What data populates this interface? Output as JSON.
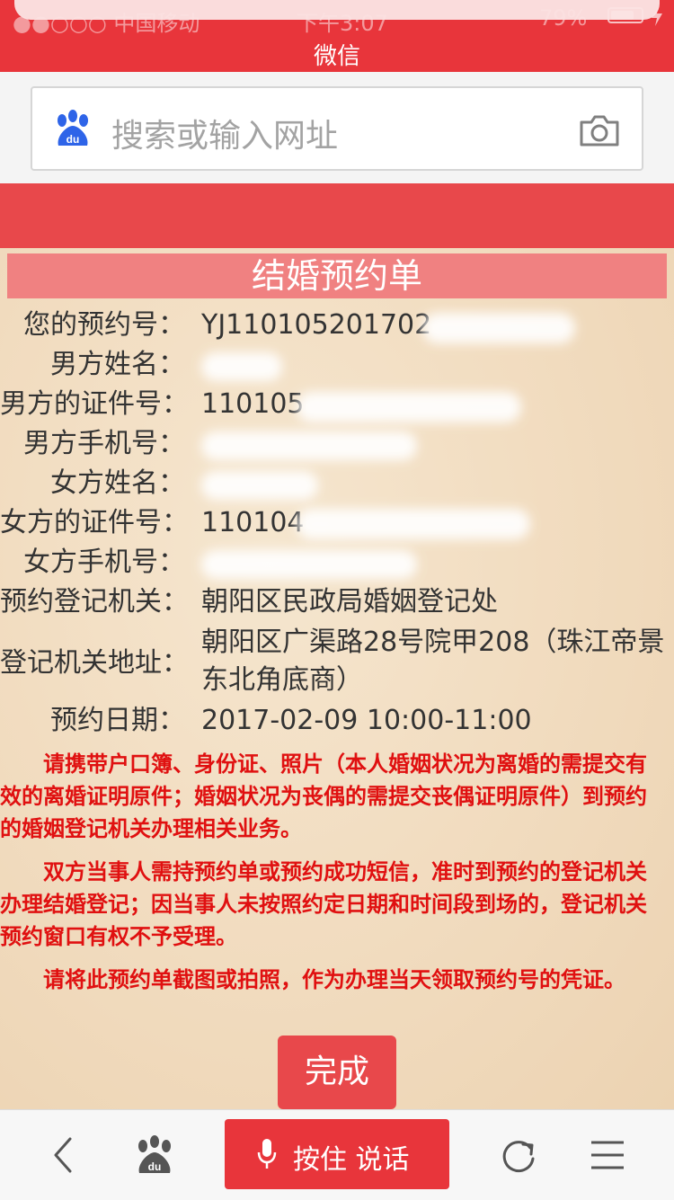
{
  "status_bar": {
    "carrier": "●●○○○ 中国移动",
    "time": "下午3:07",
    "battery": "79%",
    "battery_level": 0.79,
    "title": "微信"
  },
  "search": {
    "placeholder": "搜索或输入网址"
  },
  "form": {
    "title": "结婚预约单",
    "fields": [
      {
        "label": "您的预约号：",
        "value": "YJ110105201702"
      },
      {
        "label": "男方姓名：",
        "value": ""
      },
      {
        "label": "男方的证件号：",
        "value": "110105"
      },
      {
        "label": "男方手机号：",
        "value": ""
      },
      {
        "label": "女方姓名：",
        "value": ""
      },
      {
        "label": "女方的证件号：",
        "value": "110104"
      },
      {
        "label": "女方手机号：",
        "value": ""
      },
      {
        "label": "预约登记机关：",
        "value": "朝阳区民政局婚姻登记处"
      }
    ],
    "address_label": "登记机关地址：",
    "address_value": "朝阳区广渠路28号院甲208（珠江帝景东北角底商）",
    "date_label": "预约日期：",
    "date_value": "2017-02-09 10:00-11:00"
  },
  "notices": [
    "请携带户口簿、身份证、照片（本人婚姻状况为离婚的需提交有效的离婚证明原件；婚姻状况为丧偶的需提交丧偶证明原件）到预约的婚姻登记机关办理相关业务。",
    "双方当事人需持预约单或预约成功短信，准时到预约的登记机关办理结婚登记；因当事人未按照约定日期和时间段到场的，登记机关预约窗口有权不予受理。",
    "请将此预约单截图或拍照，作为办理当天领取预约号的凭证。"
  ],
  "done_button": "完成",
  "bottom_bar": {
    "voice_label": "按住 说话"
  },
  "colors": {
    "brand_red": "#e8353b",
    "notice_red": "#e01010",
    "title_pink": "#f08181"
  },
  "icons": [
    "baidu-paw-icon",
    "camera-icon",
    "back-arrow-icon",
    "microphone-icon",
    "refresh-icon",
    "menu-icon"
  ]
}
